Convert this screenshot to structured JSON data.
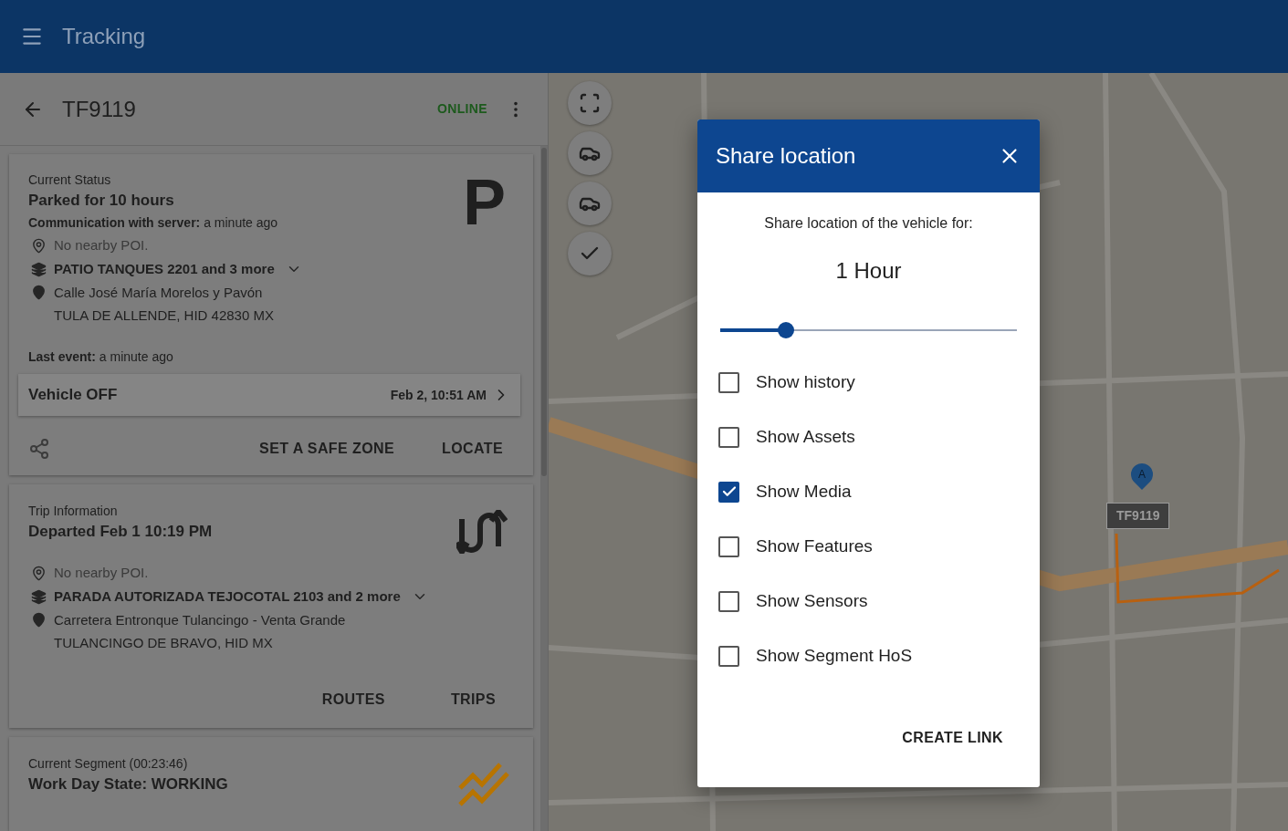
{
  "app_bar": {
    "title": "Tracking"
  },
  "vehicle_header": {
    "name": "TF9119",
    "status": "ONLINE"
  },
  "status_card": {
    "heading": "Current Status",
    "title": "Parked for 10 hours",
    "badge": "P",
    "communication": {
      "label": "Communication with server:",
      "value": "a minute ago"
    },
    "poi": "No nearby POI.",
    "geofence": "PATIO TANQUES 2201 and 3 more",
    "address_lines": [
      "Calle José María Morelos y Pavón",
      "TULA DE ALLENDE, HID 42830 MX"
    ],
    "last_event": {
      "label": "Last event:",
      "value": "a minute ago"
    },
    "event": {
      "label": "Vehicle OFF",
      "time": "Feb 2, 10:51 AM"
    },
    "actions": [
      "SET A SAFE ZONE",
      "LOCATE"
    ]
  },
  "trip_card": {
    "heading": "Trip Information",
    "title": "Departed Feb 1 10:19 PM",
    "poi": "No nearby POI.",
    "geofence": "PARADA AUTORIZADA TEJOCOTAL 2103 and 2 more",
    "address_lines": [
      "Carretera Entronque Tulancingo - Venta Grande",
      "TULANCINGO DE BRAVO, HID MX"
    ],
    "actions": [
      "ROUTES",
      "TRIPS"
    ]
  },
  "segment_card": {
    "heading": "Current Segment (00:23:46)",
    "title": "Work Day State: WORKING"
  },
  "map": {
    "vehicle_label": "TF9119",
    "marker_letter": "A"
  },
  "dialog": {
    "title": "Share location",
    "prompt": "Share location of the vehicle for:",
    "duration": "1 Hour",
    "level": 0.22,
    "options": [
      {
        "label": "Show history",
        "checked": false
      },
      {
        "label": "Show Assets",
        "checked": false
      },
      {
        "label": "Show Media",
        "checked": true
      },
      {
        "label": "Show Features",
        "checked": false
      },
      {
        "label": "Show Sensors",
        "checked": false
      },
      {
        "label": "Show Segment HoS",
        "checked": false
      }
    ],
    "action": "CREATE LINK"
  }
}
